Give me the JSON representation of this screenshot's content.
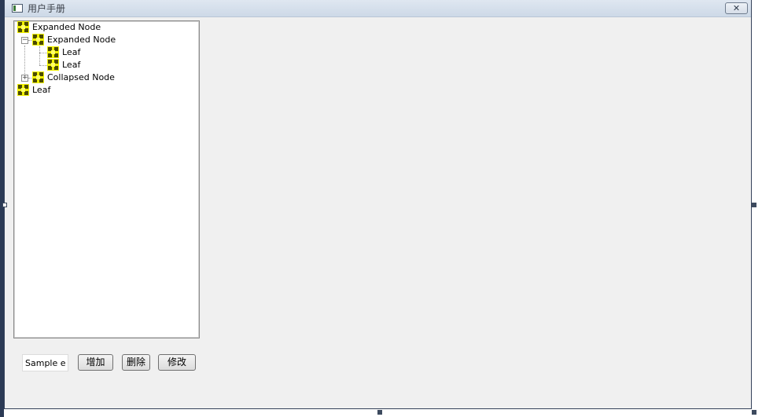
{
  "window": {
    "title": "用户手册",
    "close_glyph": "✕"
  },
  "tree": {
    "nodes": [
      {
        "label": "Expanded Node",
        "level": 0,
        "icon": "node-icon"
      },
      {
        "label": "Expanded Node",
        "level": 1,
        "expander": "−",
        "icon": "node-icon"
      },
      {
        "label": "Leaf",
        "level": 2,
        "icon": "node-icon"
      },
      {
        "label": "Leaf",
        "level": 2,
        "icon": "node-icon"
      },
      {
        "label": "Collapsed Node",
        "level": 1,
        "expander": "+",
        "icon": "node-icon"
      },
      {
        "label": "Leaf",
        "level": 0,
        "icon": "node-icon"
      }
    ]
  },
  "controls": {
    "edit_value": "Sample edit",
    "add_label": "增加",
    "delete_label": "删除",
    "modify_label": "修改"
  },
  "colors": {
    "icon_yellow": "#ffff00",
    "icon_dark": "#4a4a00",
    "frame": "#34425a"
  }
}
